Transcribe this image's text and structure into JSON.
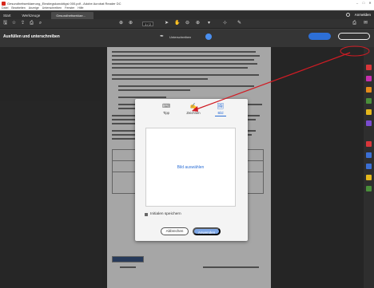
{
  "window": {
    "title": "Gesundheitserklaerung_Einstiegskoncktigsi 000.pdf - Adobe Acrobat Reader DC",
    "controls": [
      "–",
      "□",
      "✕"
    ]
  },
  "menu": [
    "Datei",
    "Bearbeiten",
    "Anzeige",
    "Unterschreiben",
    "Fenster",
    "Hilfe"
  ],
  "tabs": {
    "start": "Start",
    "werkzeuge": "Werkzeuge",
    "document": "Gesundheitserklae...",
    "signin": "Anmelden"
  },
  "toolbar": {
    "page_indicator": "1 / 2"
  },
  "signbar": {
    "label": "Ausfüllen und unterschreiben",
    "center_label": "Unterschreiben"
  },
  "dialog": {
    "tabs": [
      {
        "label": "Tipp",
        "icon": "keyboard-icon"
      },
      {
        "label": "Zeichnen",
        "icon": "draw-icon"
      },
      {
        "label": "Bild",
        "icon": "image-icon"
      }
    ],
    "active_tab": "Bild",
    "select_image": "Bild auswählen",
    "save_initials": "Initialen speichern",
    "cancel": "Abbrechen",
    "apply": "Anwenden"
  },
  "colors": {
    "accent": "#2d6fd6",
    "arrow": "#d01c24"
  }
}
